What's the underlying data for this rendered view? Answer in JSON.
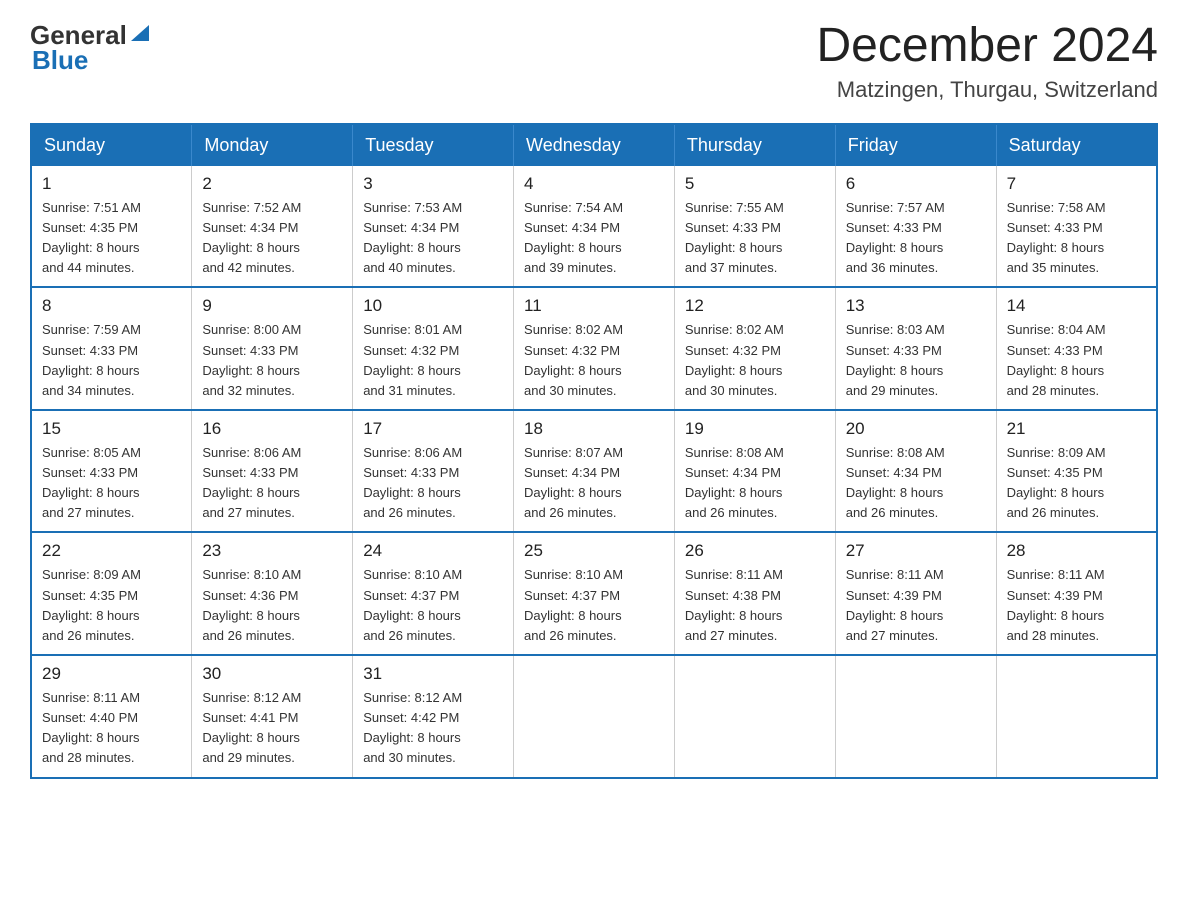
{
  "logo": {
    "text_general": "General",
    "text_blue": "Blue"
  },
  "header": {
    "month_year": "December 2024",
    "location": "Matzingen, Thurgau, Switzerland"
  },
  "weekdays": [
    "Sunday",
    "Monday",
    "Tuesday",
    "Wednesday",
    "Thursday",
    "Friday",
    "Saturday"
  ],
  "weeks": [
    [
      {
        "day": "1",
        "info": "Sunrise: 7:51 AM\nSunset: 4:35 PM\nDaylight: 8 hours\nand 44 minutes."
      },
      {
        "day": "2",
        "info": "Sunrise: 7:52 AM\nSunset: 4:34 PM\nDaylight: 8 hours\nand 42 minutes."
      },
      {
        "day": "3",
        "info": "Sunrise: 7:53 AM\nSunset: 4:34 PM\nDaylight: 8 hours\nand 40 minutes."
      },
      {
        "day": "4",
        "info": "Sunrise: 7:54 AM\nSunset: 4:34 PM\nDaylight: 8 hours\nand 39 minutes."
      },
      {
        "day": "5",
        "info": "Sunrise: 7:55 AM\nSunset: 4:33 PM\nDaylight: 8 hours\nand 37 minutes."
      },
      {
        "day": "6",
        "info": "Sunrise: 7:57 AM\nSunset: 4:33 PM\nDaylight: 8 hours\nand 36 minutes."
      },
      {
        "day": "7",
        "info": "Sunrise: 7:58 AM\nSunset: 4:33 PM\nDaylight: 8 hours\nand 35 minutes."
      }
    ],
    [
      {
        "day": "8",
        "info": "Sunrise: 7:59 AM\nSunset: 4:33 PM\nDaylight: 8 hours\nand 34 minutes."
      },
      {
        "day": "9",
        "info": "Sunrise: 8:00 AM\nSunset: 4:33 PM\nDaylight: 8 hours\nand 32 minutes."
      },
      {
        "day": "10",
        "info": "Sunrise: 8:01 AM\nSunset: 4:32 PM\nDaylight: 8 hours\nand 31 minutes."
      },
      {
        "day": "11",
        "info": "Sunrise: 8:02 AM\nSunset: 4:32 PM\nDaylight: 8 hours\nand 30 minutes."
      },
      {
        "day": "12",
        "info": "Sunrise: 8:02 AM\nSunset: 4:32 PM\nDaylight: 8 hours\nand 30 minutes."
      },
      {
        "day": "13",
        "info": "Sunrise: 8:03 AM\nSunset: 4:33 PM\nDaylight: 8 hours\nand 29 minutes."
      },
      {
        "day": "14",
        "info": "Sunrise: 8:04 AM\nSunset: 4:33 PM\nDaylight: 8 hours\nand 28 minutes."
      }
    ],
    [
      {
        "day": "15",
        "info": "Sunrise: 8:05 AM\nSunset: 4:33 PM\nDaylight: 8 hours\nand 27 minutes."
      },
      {
        "day": "16",
        "info": "Sunrise: 8:06 AM\nSunset: 4:33 PM\nDaylight: 8 hours\nand 27 minutes."
      },
      {
        "day": "17",
        "info": "Sunrise: 8:06 AM\nSunset: 4:33 PM\nDaylight: 8 hours\nand 26 minutes."
      },
      {
        "day": "18",
        "info": "Sunrise: 8:07 AM\nSunset: 4:34 PM\nDaylight: 8 hours\nand 26 minutes."
      },
      {
        "day": "19",
        "info": "Sunrise: 8:08 AM\nSunset: 4:34 PM\nDaylight: 8 hours\nand 26 minutes."
      },
      {
        "day": "20",
        "info": "Sunrise: 8:08 AM\nSunset: 4:34 PM\nDaylight: 8 hours\nand 26 minutes."
      },
      {
        "day": "21",
        "info": "Sunrise: 8:09 AM\nSunset: 4:35 PM\nDaylight: 8 hours\nand 26 minutes."
      }
    ],
    [
      {
        "day": "22",
        "info": "Sunrise: 8:09 AM\nSunset: 4:35 PM\nDaylight: 8 hours\nand 26 minutes."
      },
      {
        "day": "23",
        "info": "Sunrise: 8:10 AM\nSunset: 4:36 PM\nDaylight: 8 hours\nand 26 minutes."
      },
      {
        "day": "24",
        "info": "Sunrise: 8:10 AM\nSunset: 4:37 PM\nDaylight: 8 hours\nand 26 minutes."
      },
      {
        "day": "25",
        "info": "Sunrise: 8:10 AM\nSunset: 4:37 PM\nDaylight: 8 hours\nand 26 minutes."
      },
      {
        "day": "26",
        "info": "Sunrise: 8:11 AM\nSunset: 4:38 PM\nDaylight: 8 hours\nand 27 minutes."
      },
      {
        "day": "27",
        "info": "Sunrise: 8:11 AM\nSunset: 4:39 PM\nDaylight: 8 hours\nand 27 minutes."
      },
      {
        "day": "28",
        "info": "Sunrise: 8:11 AM\nSunset: 4:39 PM\nDaylight: 8 hours\nand 28 minutes."
      }
    ],
    [
      {
        "day": "29",
        "info": "Sunrise: 8:11 AM\nSunset: 4:40 PM\nDaylight: 8 hours\nand 28 minutes."
      },
      {
        "day": "30",
        "info": "Sunrise: 8:12 AM\nSunset: 4:41 PM\nDaylight: 8 hours\nand 29 minutes."
      },
      {
        "day": "31",
        "info": "Sunrise: 8:12 AM\nSunset: 4:42 PM\nDaylight: 8 hours\nand 30 minutes."
      },
      {
        "day": "",
        "info": ""
      },
      {
        "day": "",
        "info": ""
      },
      {
        "day": "",
        "info": ""
      },
      {
        "day": "",
        "info": ""
      }
    ]
  ]
}
